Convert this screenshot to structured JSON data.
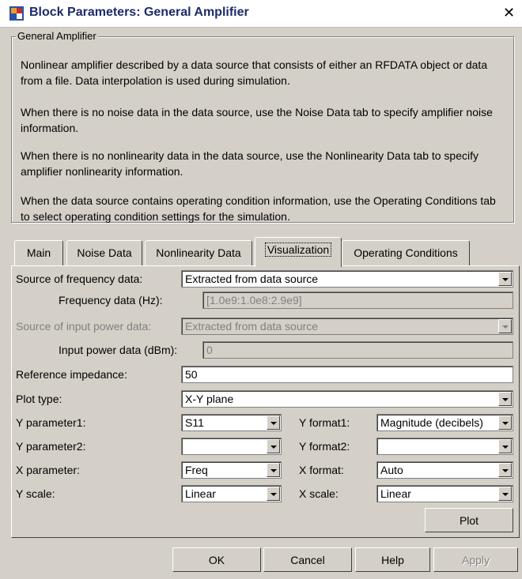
{
  "window": {
    "title": "Block Parameters: General Amplifier",
    "close_glyph": "✕"
  },
  "group": {
    "legend": "General Amplifier",
    "paragraphs": [
      "Nonlinear amplifier described by a data source that consists of either an RFDATA object or data from a file. Data interpolation is used during simulation.",
      "When there is no noise data in the data source, use the Noise Data tab to specify amplifier noise information.",
      "When there is no nonlinearity data in the data source, use the Nonlinearity Data tab to specify amplifier nonlinearity information.",
      "When the data source contains operating condition information, use the Operating Conditions tab to select operating condition settings for the simulation."
    ]
  },
  "tabs": [
    "Main",
    "Noise Data",
    "Nonlinearity Data",
    "Visualization",
    "Operating Conditions"
  ],
  "active_tab": "Visualization",
  "form": {
    "source_freq": {
      "label": "Source of frequency data:",
      "value": "Extracted from data source"
    },
    "freq_data": {
      "label": "Frequency data (Hz):",
      "value": "[1.0e9:1.0e8:2.9e9]"
    },
    "source_power": {
      "label": "Source of input power data:",
      "value": "Extracted from data source"
    },
    "power_data": {
      "label": "Input power data (dBm):",
      "value": "0"
    },
    "ref_impedance": {
      "label": "Reference impedance:",
      "value": "50"
    },
    "plot_type": {
      "label": "Plot type:",
      "value": "X-Y plane"
    },
    "y_param1": {
      "label": "Y parameter1:",
      "value": "S11"
    },
    "y_format1": {
      "label": "Y format1:",
      "value": "Magnitude (decibels)"
    },
    "y_param2": {
      "label": "Y parameter2:",
      "value": ""
    },
    "y_format2": {
      "label": "Y format2:",
      "value": ""
    },
    "x_param": {
      "label": "X parameter:",
      "value": "Freq"
    },
    "x_format": {
      "label": "X format:",
      "value": "Auto"
    },
    "y_scale": {
      "label": "Y scale:",
      "value": "Linear"
    },
    "x_scale": {
      "label": "X scale:",
      "value": "Linear"
    },
    "plot_button": "Plot"
  },
  "buttons": {
    "ok": "OK",
    "cancel": "Cancel",
    "help": "Help",
    "apply": "Apply"
  }
}
